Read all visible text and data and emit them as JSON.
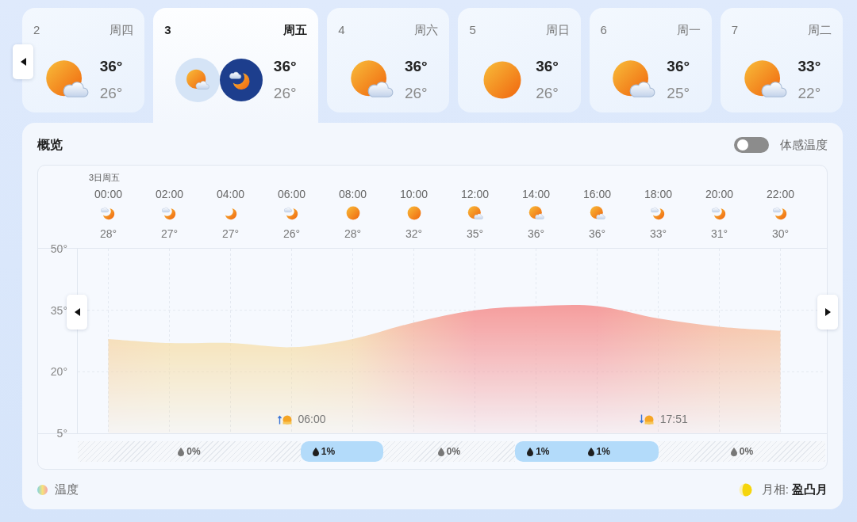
{
  "days": [
    {
      "day": "2",
      "weekday": "周四",
      "kind": "partly-cloudy",
      "high": "36°",
      "low": "26°",
      "selected": false
    },
    {
      "day": "3",
      "weekday": "周五",
      "kind": "day-night",
      "high": "36°",
      "low": "26°",
      "selected": true
    },
    {
      "day": "4",
      "weekday": "周六",
      "kind": "partly-cloudy",
      "high": "36°",
      "low": "26°",
      "selected": false
    },
    {
      "day": "5",
      "weekday": "周日",
      "kind": "sunny",
      "high": "36°",
      "low": "26°",
      "selected": false
    },
    {
      "day": "6",
      "weekday": "周一",
      "kind": "partly-cloudy",
      "high": "36°",
      "low": "25°",
      "selected": false
    },
    {
      "day": "7",
      "weekday": "周二",
      "kind": "partly-cloudy",
      "high": "33°",
      "low": "22°",
      "selected": false
    }
  ],
  "overview": {
    "title": "概览",
    "feels_like": {
      "label": "体感温度",
      "on": false
    },
    "date_label": "3日周五",
    "hours": [
      {
        "time": "00:00",
        "kind": "cloudy-night",
        "temp": "28°"
      },
      {
        "time": "02:00",
        "kind": "cloudy-night",
        "temp": "27°"
      },
      {
        "time": "04:00",
        "kind": "night",
        "temp": "27°"
      },
      {
        "time": "06:00",
        "kind": "cloudy-night",
        "temp": "26°"
      },
      {
        "time": "08:00",
        "kind": "sunny",
        "temp": "28°"
      },
      {
        "time": "10:00",
        "kind": "sunny",
        "temp": "32°"
      },
      {
        "time": "12:00",
        "kind": "partly-cloudy",
        "temp": "35°"
      },
      {
        "time": "14:00",
        "kind": "partly-cloudy",
        "temp": "36°"
      },
      {
        "time": "16:00",
        "kind": "partly-cloudy",
        "temp": "36°"
      },
      {
        "time": "18:00",
        "kind": "cloudy-night",
        "temp": "33°"
      },
      {
        "time": "20:00",
        "kind": "cloudy-night",
        "temp": "31°"
      },
      {
        "time": "22:00",
        "kind": "cloudy-night",
        "temp": "30°"
      }
    ],
    "chart_data": {
      "type": "area",
      "values": [
        28,
        27,
        27,
        26,
        28,
        32,
        35,
        36,
        36,
        33,
        31,
        30
      ],
      "ylim": [
        5,
        50
      ],
      "yticks": [
        {
          "value": 50,
          "label": "50°"
        },
        {
          "value": 35,
          "label": "35°"
        },
        {
          "value": 20,
          "label": "20°"
        },
        {
          "value": 5,
          "label": "5°"
        }
      ],
      "grid": true
    },
    "sun_events": [
      {
        "kind": "sunrise",
        "time": "06:00"
      },
      {
        "kind": "sunset",
        "time": "17:51"
      }
    ],
    "precipitation": [
      {
        "rain": false,
        "labels": [
          "0%"
        ]
      },
      {
        "rain": true,
        "labels": [
          "1%"
        ]
      },
      {
        "rain": false,
        "labels": [
          "0%"
        ]
      },
      {
        "rain": true,
        "labels": [
          "1%",
          "1%"
        ]
      },
      {
        "rain": false,
        "labels": [
          "0%"
        ]
      }
    ],
    "legend": "温度",
    "moon_phase": "月相: **盈凸月**"
  }
}
